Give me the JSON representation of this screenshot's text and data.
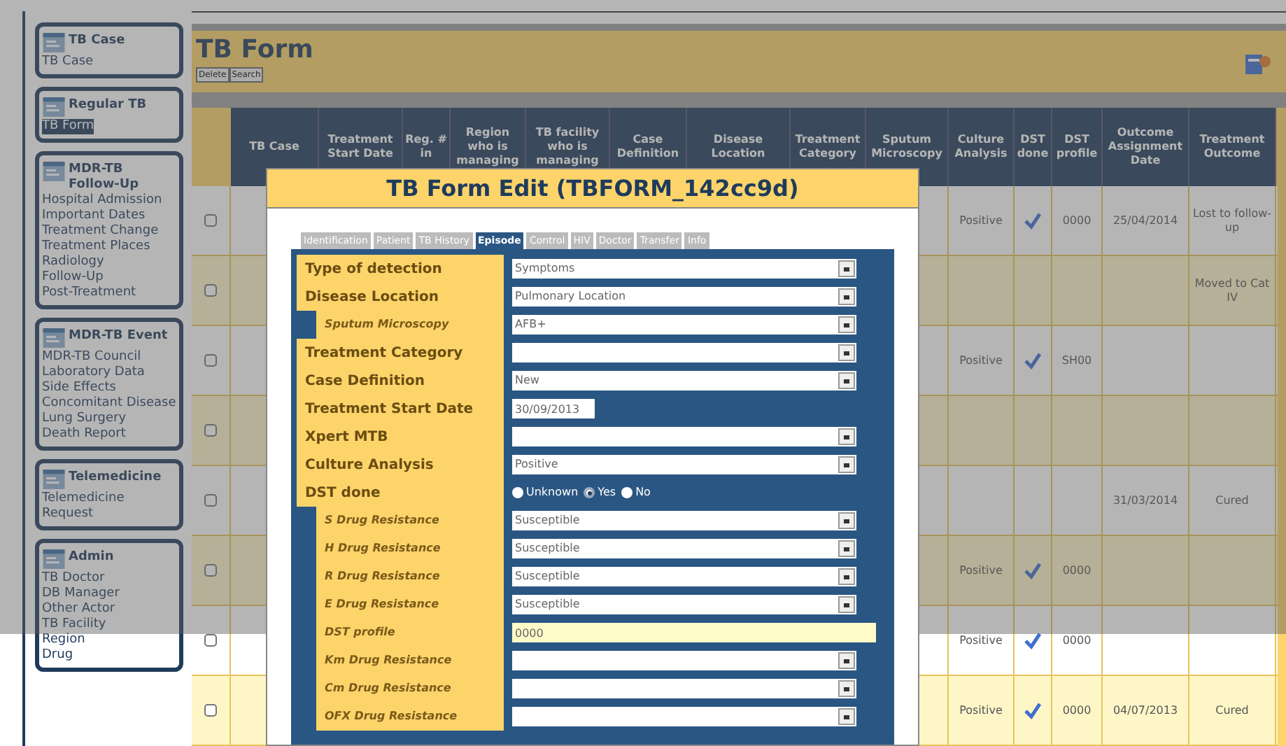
{
  "sidebar": {
    "groups": [
      {
        "title": "TB Case",
        "items": [
          {
            "label": "TB Case",
            "selected": false
          }
        ]
      },
      {
        "title": "Regular TB",
        "items": [
          {
            "label": "TB Form",
            "selected": true
          }
        ]
      },
      {
        "title": "MDR-TB Follow-Up",
        "items": [
          {
            "label": "Hospital Admission",
            "selected": false
          },
          {
            "label": "Important Dates",
            "selected": false
          },
          {
            "label": "Treatment Change",
            "selected": false
          },
          {
            "label": "Treatment Places",
            "selected": false
          },
          {
            "label": "Radiology",
            "selected": false
          },
          {
            "label": "Follow-Up",
            "selected": false
          },
          {
            "label": "Post-Treatment",
            "selected": false
          }
        ]
      },
      {
        "title": "MDR-TB Event",
        "items": [
          {
            "label": "MDR-TB Council",
            "selected": false
          },
          {
            "label": "Laboratory Data",
            "selected": false
          },
          {
            "label": "Side Effects",
            "selected": false
          },
          {
            "label": "Concomitant Disease",
            "selected": false
          },
          {
            "label": "Lung Surgery",
            "selected": false
          },
          {
            "label": "Death Report",
            "selected": false
          }
        ]
      },
      {
        "title": "Telemedicine",
        "items": [
          {
            "label": "Telemedicine Request",
            "selected": false
          }
        ]
      },
      {
        "title": "Admin",
        "items": [
          {
            "label": "TB Doctor",
            "selected": false
          },
          {
            "label": "DB Manager",
            "selected": false
          },
          {
            "label": "Other Actor",
            "selected": false
          },
          {
            "label": "TB Facility",
            "selected": false
          },
          {
            "label": "Region",
            "selected": false
          },
          {
            "label": "Drug",
            "selected": false
          }
        ]
      }
    ]
  },
  "page": {
    "title": "TB Form",
    "buttons": [
      "Delete",
      "Search"
    ]
  },
  "table": {
    "columns": [
      "TB Case",
      "Treatment Start Date",
      "Reg. # in",
      "Region who is managing",
      "TB facility who is managing",
      "Case Definition",
      "Disease Location",
      "Treatment Category",
      "Sputum Microscopy",
      "Culture Analysis",
      "DST done",
      "DST profile",
      "Outcome Assignment Date",
      "Treatment Outcome"
    ],
    "rows": [
      {
        "checked": false,
        "culture": "Positive",
        "dst_done": true,
        "dst_profile": "0000",
        "outcome_date": "25/04/2014",
        "outcome": "Lost to follow-up"
      },
      {
        "checked": false,
        "dst_done": false,
        "outcome": "Moved to Cat IV"
      },
      {
        "checked": false,
        "culture": "Positive",
        "dst_done": true,
        "dst_profile": "SH00"
      },
      {
        "checked": false,
        "dst_done": false
      },
      {
        "checked": false,
        "dst_done": false,
        "outcome_date": "31/03/2014",
        "outcome": "Cured"
      },
      {
        "checked": false,
        "culture": "Positive",
        "dst_done": true,
        "dst_profile": "0000"
      },
      {
        "checked": false,
        "culture": "Positive",
        "dst_done": true,
        "dst_profile": "0000"
      },
      {
        "checked": false,
        "culture": "Positive",
        "dst_done": true,
        "dst_profile": "0000",
        "outcome_date": "04/07/2013",
        "outcome": "Cured"
      }
    ]
  },
  "dialog": {
    "title": "TB Form Edit (TBFORM_142cc9d)",
    "tabs": [
      {
        "label": "Identification",
        "selected": false
      },
      {
        "label": "Patient",
        "selected": false
      },
      {
        "label": "TB History",
        "selected": false
      },
      {
        "label": "Episode",
        "selected": true
      },
      {
        "label": "Control",
        "selected": false
      },
      {
        "label": "HIV",
        "selected": false
      },
      {
        "label": "Doctor",
        "selected": false
      },
      {
        "label": "Transfer",
        "selected": false
      },
      {
        "label": "Info",
        "selected": false
      }
    ],
    "fields": [
      {
        "label": "Type of detection",
        "kind": "select",
        "sub": false,
        "value": "Symptoms"
      },
      {
        "label": "Disease Location",
        "kind": "select",
        "sub": false,
        "value": "Pulmonary Location"
      },
      {
        "label": "Sputum Microscopy",
        "kind": "select",
        "sub": true,
        "value": "AFB+"
      },
      {
        "label": "Treatment Category",
        "kind": "select",
        "sub": false
      },
      {
        "label": "Case Definition",
        "kind": "select",
        "sub": false,
        "value": "New"
      },
      {
        "label": "Treatment Start Date",
        "kind": "date",
        "sub": false,
        "value": "30/09/2013"
      },
      {
        "label": "Xpert MTB",
        "kind": "select",
        "sub": false
      },
      {
        "label": "Culture Analysis",
        "kind": "select",
        "sub": false,
        "value": "Positive"
      },
      {
        "label": "DST done",
        "kind": "radio",
        "sub": false,
        "options": [
          {
            "label": "Unknown",
            "selected": false
          },
          {
            "label": "Yes",
            "selected": true
          },
          {
            "label": "No",
            "selected": false
          }
        ]
      },
      {
        "label": "S Drug Resistance",
        "kind": "select",
        "sub": true,
        "value": "Susceptible"
      },
      {
        "label": "H Drug Resistance",
        "kind": "select",
        "sub": true,
        "value": "Susceptible"
      },
      {
        "label": "R Drug Resistance",
        "kind": "select",
        "sub": true,
        "value": "Susceptible"
      },
      {
        "label": "E Drug Resistance",
        "kind": "select",
        "sub": true,
        "value": "Susceptible"
      },
      {
        "label": "DST profile",
        "kind": "text",
        "sub": true,
        "value": "0000"
      },
      {
        "label": "Km Drug Resistance",
        "kind": "select",
        "sub": true
      },
      {
        "label": "Cm Drug Resistance",
        "kind": "select",
        "sub": true
      },
      {
        "label": "OFX Drug Resistance",
        "kind": "select",
        "sub": true
      }
    ]
  }
}
